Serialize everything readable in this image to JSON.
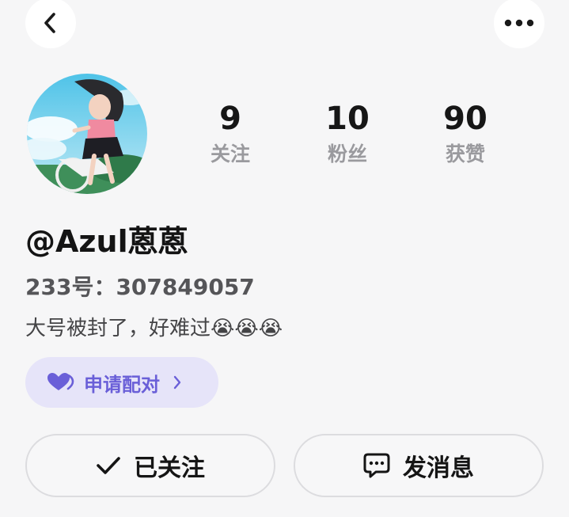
{
  "header": {
    "back_icon": "chevron-left-icon",
    "more_icon": "more-horizontal-icon"
  },
  "profile": {
    "avatar_icon": "avatar-illustration",
    "stats": {
      "following_count": "9",
      "following_label": "关注",
      "fans_count": "10",
      "fans_label": "粉丝",
      "likes_count": "90",
      "likes_label": "获赞"
    },
    "username": "@Azul蒽蒽",
    "user_id": "233号：307849057",
    "bio": "大号被封了，好难过😭😭😭"
  },
  "pair": {
    "label": "申请配对",
    "icon": "heart-icon",
    "chevron_icon": "chevron-right-icon",
    "accent_color": "#6a5fd8",
    "bg_color": "#e6e4f9"
  },
  "actions": {
    "followed_label": "已关注",
    "followed_icon": "check-icon",
    "message_label": "发消息",
    "message_icon": "chat-bubble-icon"
  }
}
